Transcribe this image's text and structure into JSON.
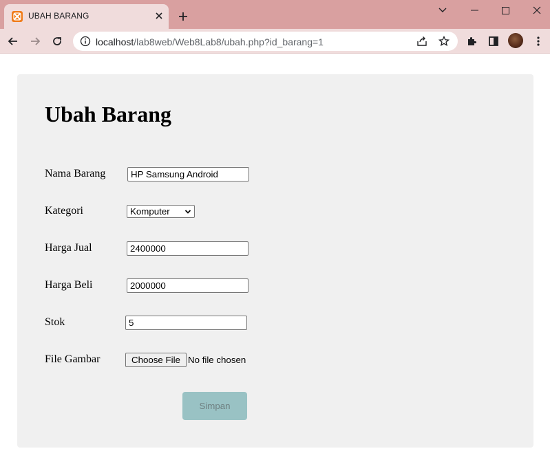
{
  "browser": {
    "tab_title": "UBAH BARANG",
    "url_host": "localhost",
    "url_path": "/lab8web/Web8Lab8/ubah.php?id_barang=1",
    "accent_color": "#d9a0a0"
  },
  "page": {
    "title": "Ubah Barang",
    "fields": {
      "nama_label": "Nama Barang",
      "nama_value": "HP Samsung Android",
      "kategori_label": "Kategori",
      "kategori_value": "Komputer",
      "harga_jual_label": "Harga Jual",
      "harga_jual_value": "2400000",
      "harga_beli_label": "Harga Beli",
      "harga_beli_value": "2000000",
      "stok_label": "Stok",
      "stok_value": "5",
      "gambar_label": "File Gambar",
      "gambar_button": "Choose File",
      "gambar_status": "No file chosen"
    },
    "submit_label": "Simpan",
    "submit_color": "#99c2c4"
  }
}
